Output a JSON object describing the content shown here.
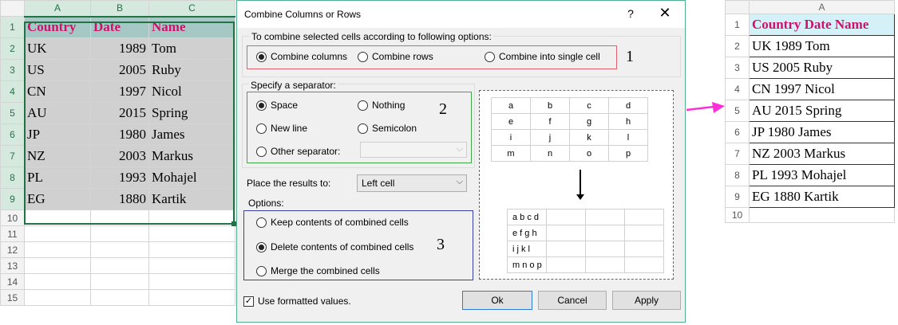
{
  "sheet": {
    "columns": [
      "A",
      "B",
      "C"
    ],
    "header": {
      "row": "1",
      "cells": [
        "Country",
        "Date",
        "Name"
      ]
    },
    "rows": [
      {
        "row": "2",
        "country": "UK",
        "date": "1989",
        "name": "Tom"
      },
      {
        "row": "3",
        "country": "US",
        "date": "2005",
        "name": "Ruby"
      },
      {
        "row": "4",
        "country": "CN",
        "date": "1997",
        "name": "Nicol"
      },
      {
        "row": "5",
        "country": "AU",
        "date": "2015",
        "name": "Spring"
      },
      {
        "row": "6",
        "country": "JP",
        "date": "1980",
        "name": "James"
      },
      {
        "row": "7",
        "country": "NZ",
        "date": "2003",
        "name": "Markus"
      },
      {
        "row": "8",
        "country": "PL",
        "date": "1993",
        "name": "Mohajel"
      },
      {
        "row": "9",
        "country": "EG",
        "date": "1880",
        "name": "Kartik"
      }
    ],
    "empty_rows": [
      "10",
      "11",
      "12",
      "13",
      "14",
      "15"
    ],
    "selection_color": "#217346",
    "header_fill": "#a6c8c4",
    "header_text_color": "#d1106d"
  },
  "dialog": {
    "title": "Combine Columns or Rows",
    "help_label": "?",
    "close_label": "✕",
    "options_caption": "To combine selected cells according to following options:",
    "combine_options": [
      {
        "label": "Combine columns",
        "selected": true
      },
      {
        "label": "Combine rows",
        "selected": false
      },
      {
        "label": "Combine into single cell",
        "selected": false
      }
    ],
    "annotation_1": "1",
    "separator_caption": "Specify a separator:",
    "separators": {
      "space": {
        "label": "Space",
        "selected": true
      },
      "nothing": {
        "label": "Nothing",
        "selected": false
      },
      "new_line": {
        "label": "New line",
        "selected": false
      },
      "semicolon": {
        "label": "Semicolon",
        "selected": false
      },
      "other": {
        "label": "Other separator:",
        "selected": false
      }
    },
    "other_separator_value": "",
    "annotation_2": "2",
    "place_label": "Place the results to:",
    "place_value": "Left cell",
    "options_label": "Options:",
    "option_choices": [
      {
        "label": "Keep contents of combined cells",
        "selected": false
      },
      {
        "label": "Delete contents of combined cells",
        "selected": true
      },
      {
        "label": "Merge the combined cells",
        "selected": false
      }
    ],
    "annotation_3": "3",
    "use_formatted_label": "Use formatted values.",
    "use_formatted_checked": true,
    "check_mark": "✓",
    "chevron": "⌵",
    "buttons": {
      "ok": "Ok",
      "cancel": "Cancel",
      "apply": "Apply"
    },
    "preview_before": [
      [
        "a",
        "b",
        "c",
        "d"
      ],
      [
        "e",
        "f",
        "g",
        "h"
      ],
      [
        "i",
        "j",
        "k",
        "l"
      ],
      [
        "m",
        "n",
        "o",
        "p"
      ]
    ],
    "preview_after": [
      [
        "a b c d",
        "",
        "",
        ""
      ],
      [
        "e f g h",
        "",
        "",
        ""
      ],
      [
        "i j k l",
        "",
        "",
        ""
      ],
      [
        "m n o p",
        "",
        "",
        ""
      ]
    ],
    "border_colors": {
      "combine": "#e0606e",
      "separator": "#3fa64a",
      "options": "#3b3fa0"
    }
  },
  "arrow_color": "#ff2fd8",
  "result": {
    "column": "A",
    "header": {
      "row": "1",
      "text": "Country Date Name"
    },
    "rows": [
      {
        "row": "2",
        "text": "UK 1989 Tom"
      },
      {
        "row": "3",
        "text": "US 2005 Ruby"
      },
      {
        "row": "4",
        "text": "CN 1997 Nicol"
      },
      {
        "row": "5",
        "text": "AU 2015 Spring"
      },
      {
        "row": "6",
        "text": "JP 1980 James"
      },
      {
        "row": "7",
        "text": "NZ 2003 Markus"
      },
      {
        "row": "8",
        "text": "PL 1993 Mohajel"
      },
      {
        "row": "9",
        "text": "EG 1880 Kartik"
      }
    ],
    "empty_rows": [
      "10"
    ]
  }
}
